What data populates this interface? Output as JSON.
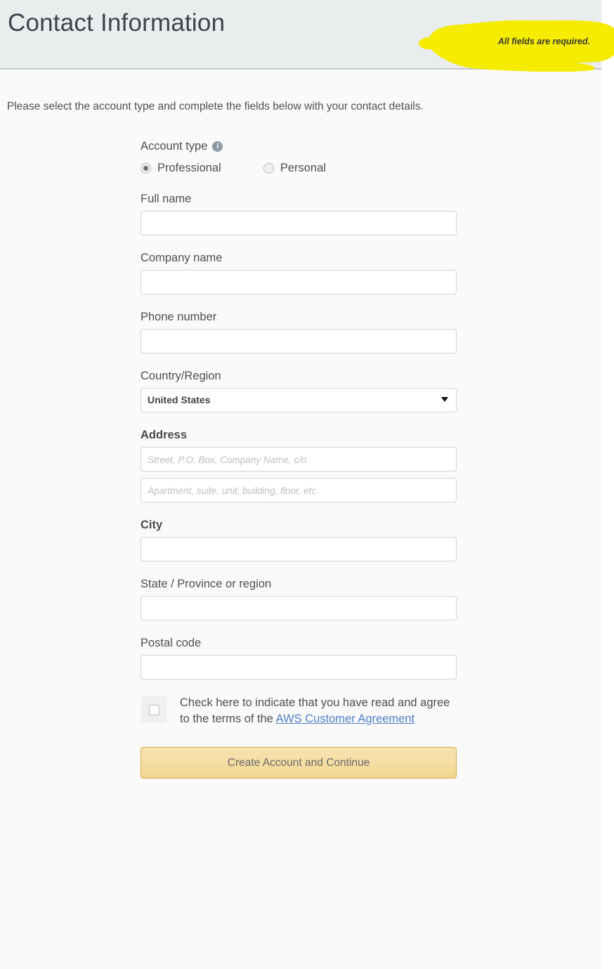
{
  "header": {
    "title": "Contact Information",
    "required_note": "All fields are required.",
    "highlight_color": "#f5ec00",
    "background_color": "#e9edee"
  },
  "intro": {
    "text": "Please select the account type and complete the fields below with your contact details."
  },
  "form": {
    "account_type": {
      "label": "Account type",
      "info_icon": "info-icon",
      "info_glyph": "i",
      "options": [
        {
          "label": "Professional",
          "selected": true
        },
        {
          "label": "Personal",
          "selected": false
        }
      ]
    },
    "fields": [
      {
        "label": "Full name",
        "value": "",
        "placeholder": ""
      },
      {
        "label": "Company name",
        "value": "",
        "placeholder": ""
      },
      {
        "label": "Phone number",
        "value": "",
        "placeholder": ""
      }
    ],
    "country": {
      "label": "Country/Region",
      "selected": "United States",
      "chevron_icon": "chevron-down-icon"
    },
    "address": {
      "label": "Address",
      "line1_placeholder": "Street, P.O. Box, Company Name, c/o",
      "line1_value": "",
      "line2_placeholder": "Apartment, suite, unit, building, floor, etc.",
      "line2_value": ""
    },
    "city": {
      "label": "City",
      "value": ""
    },
    "state": {
      "label": "State / Province or region",
      "value": ""
    },
    "postal": {
      "label": "Postal code",
      "value": ""
    },
    "agreement": {
      "text_part1": "Check here to indicate that you have read and agree to the terms of the ",
      "link_text": "AWS Customer Agreement",
      "checked": false
    },
    "submit_label": "Create Account and Continue",
    "submit_color": "#f4daa0"
  }
}
